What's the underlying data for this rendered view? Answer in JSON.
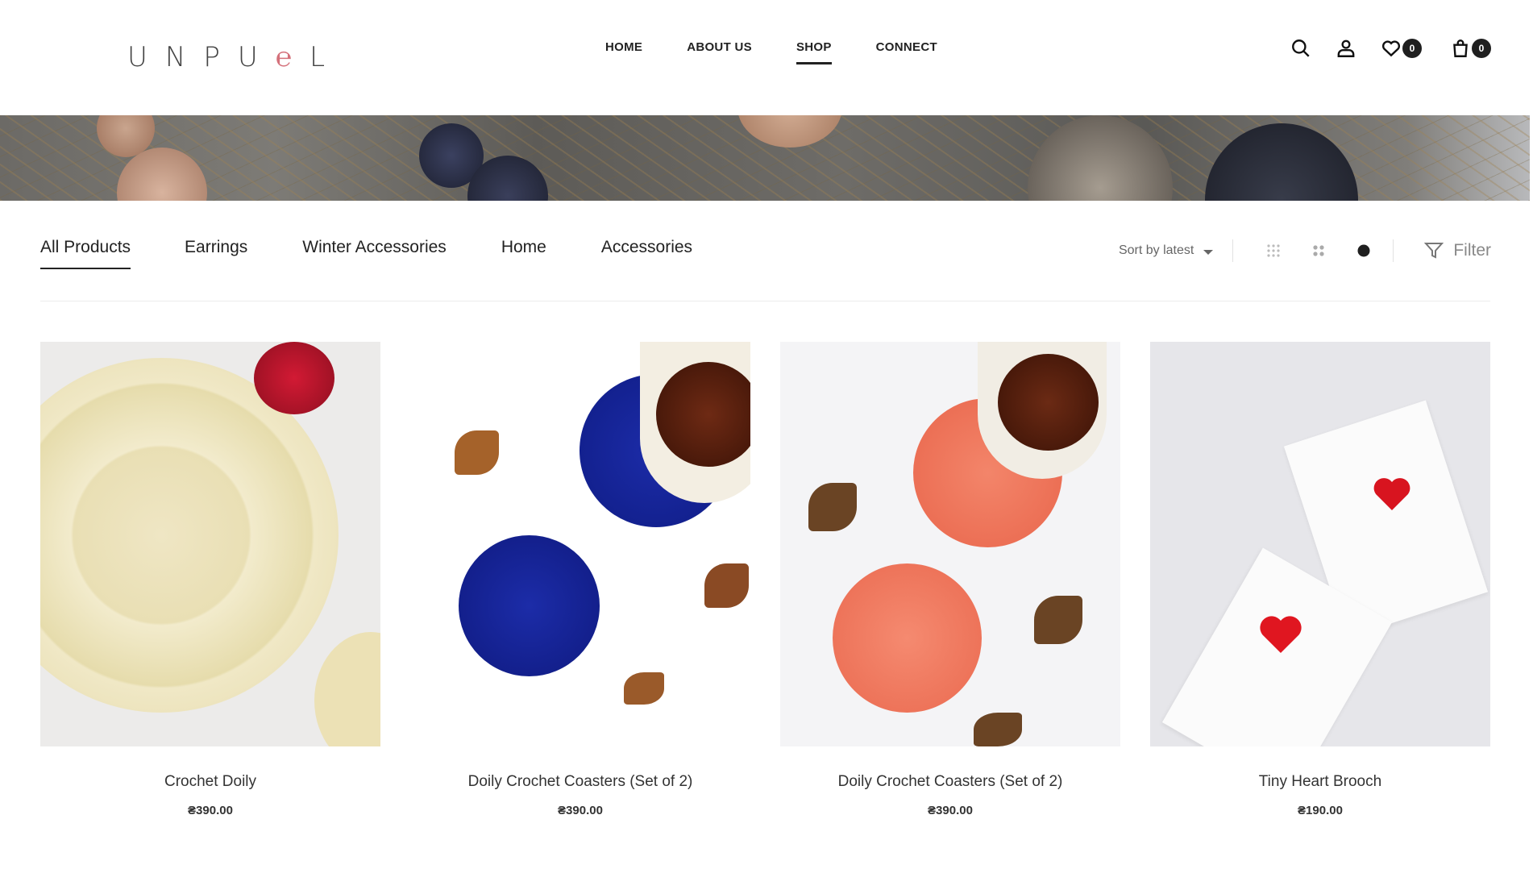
{
  "brand": {
    "logo_text_start": "UNPU",
    "logo_loop": "℮",
    "logo_text_end": "L"
  },
  "nav": [
    {
      "label": "HOME"
    },
    {
      "label": "ABOUT US"
    },
    {
      "label": "SHOP",
      "active": true
    },
    {
      "label": "CONNECT"
    }
  ],
  "header_icons": {
    "search": "search-icon",
    "account": "user-icon",
    "wishlist": "heart-icon",
    "wishlist_count": "0",
    "cart": "bag-icon",
    "cart_count": "0"
  },
  "categories": [
    {
      "label": "All Products",
      "active": true
    },
    {
      "label": "Earrings"
    },
    {
      "label": "Winter Accessories"
    },
    {
      "label": "Home"
    },
    {
      "label": "Accessories"
    }
  ],
  "toolbar": {
    "sort_label": "Sort by latest",
    "filter_label": "Filter"
  },
  "products": [
    {
      "name": "Crochet Doily",
      "price": "₴390.00"
    },
    {
      "name": "Doily Crochet Coasters (Set of 2)",
      "price": "₴390.00"
    },
    {
      "name": "Doily Crochet Coasters (Set of 2)",
      "price": "₴390.00"
    },
    {
      "name": "Tiny Heart Brooch",
      "price": "₴190.00"
    }
  ],
  "colors": {
    "text": "#222222",
    "badge": "#1f1f1f",
    "accent_logo": "#d4707a"
  }
}
